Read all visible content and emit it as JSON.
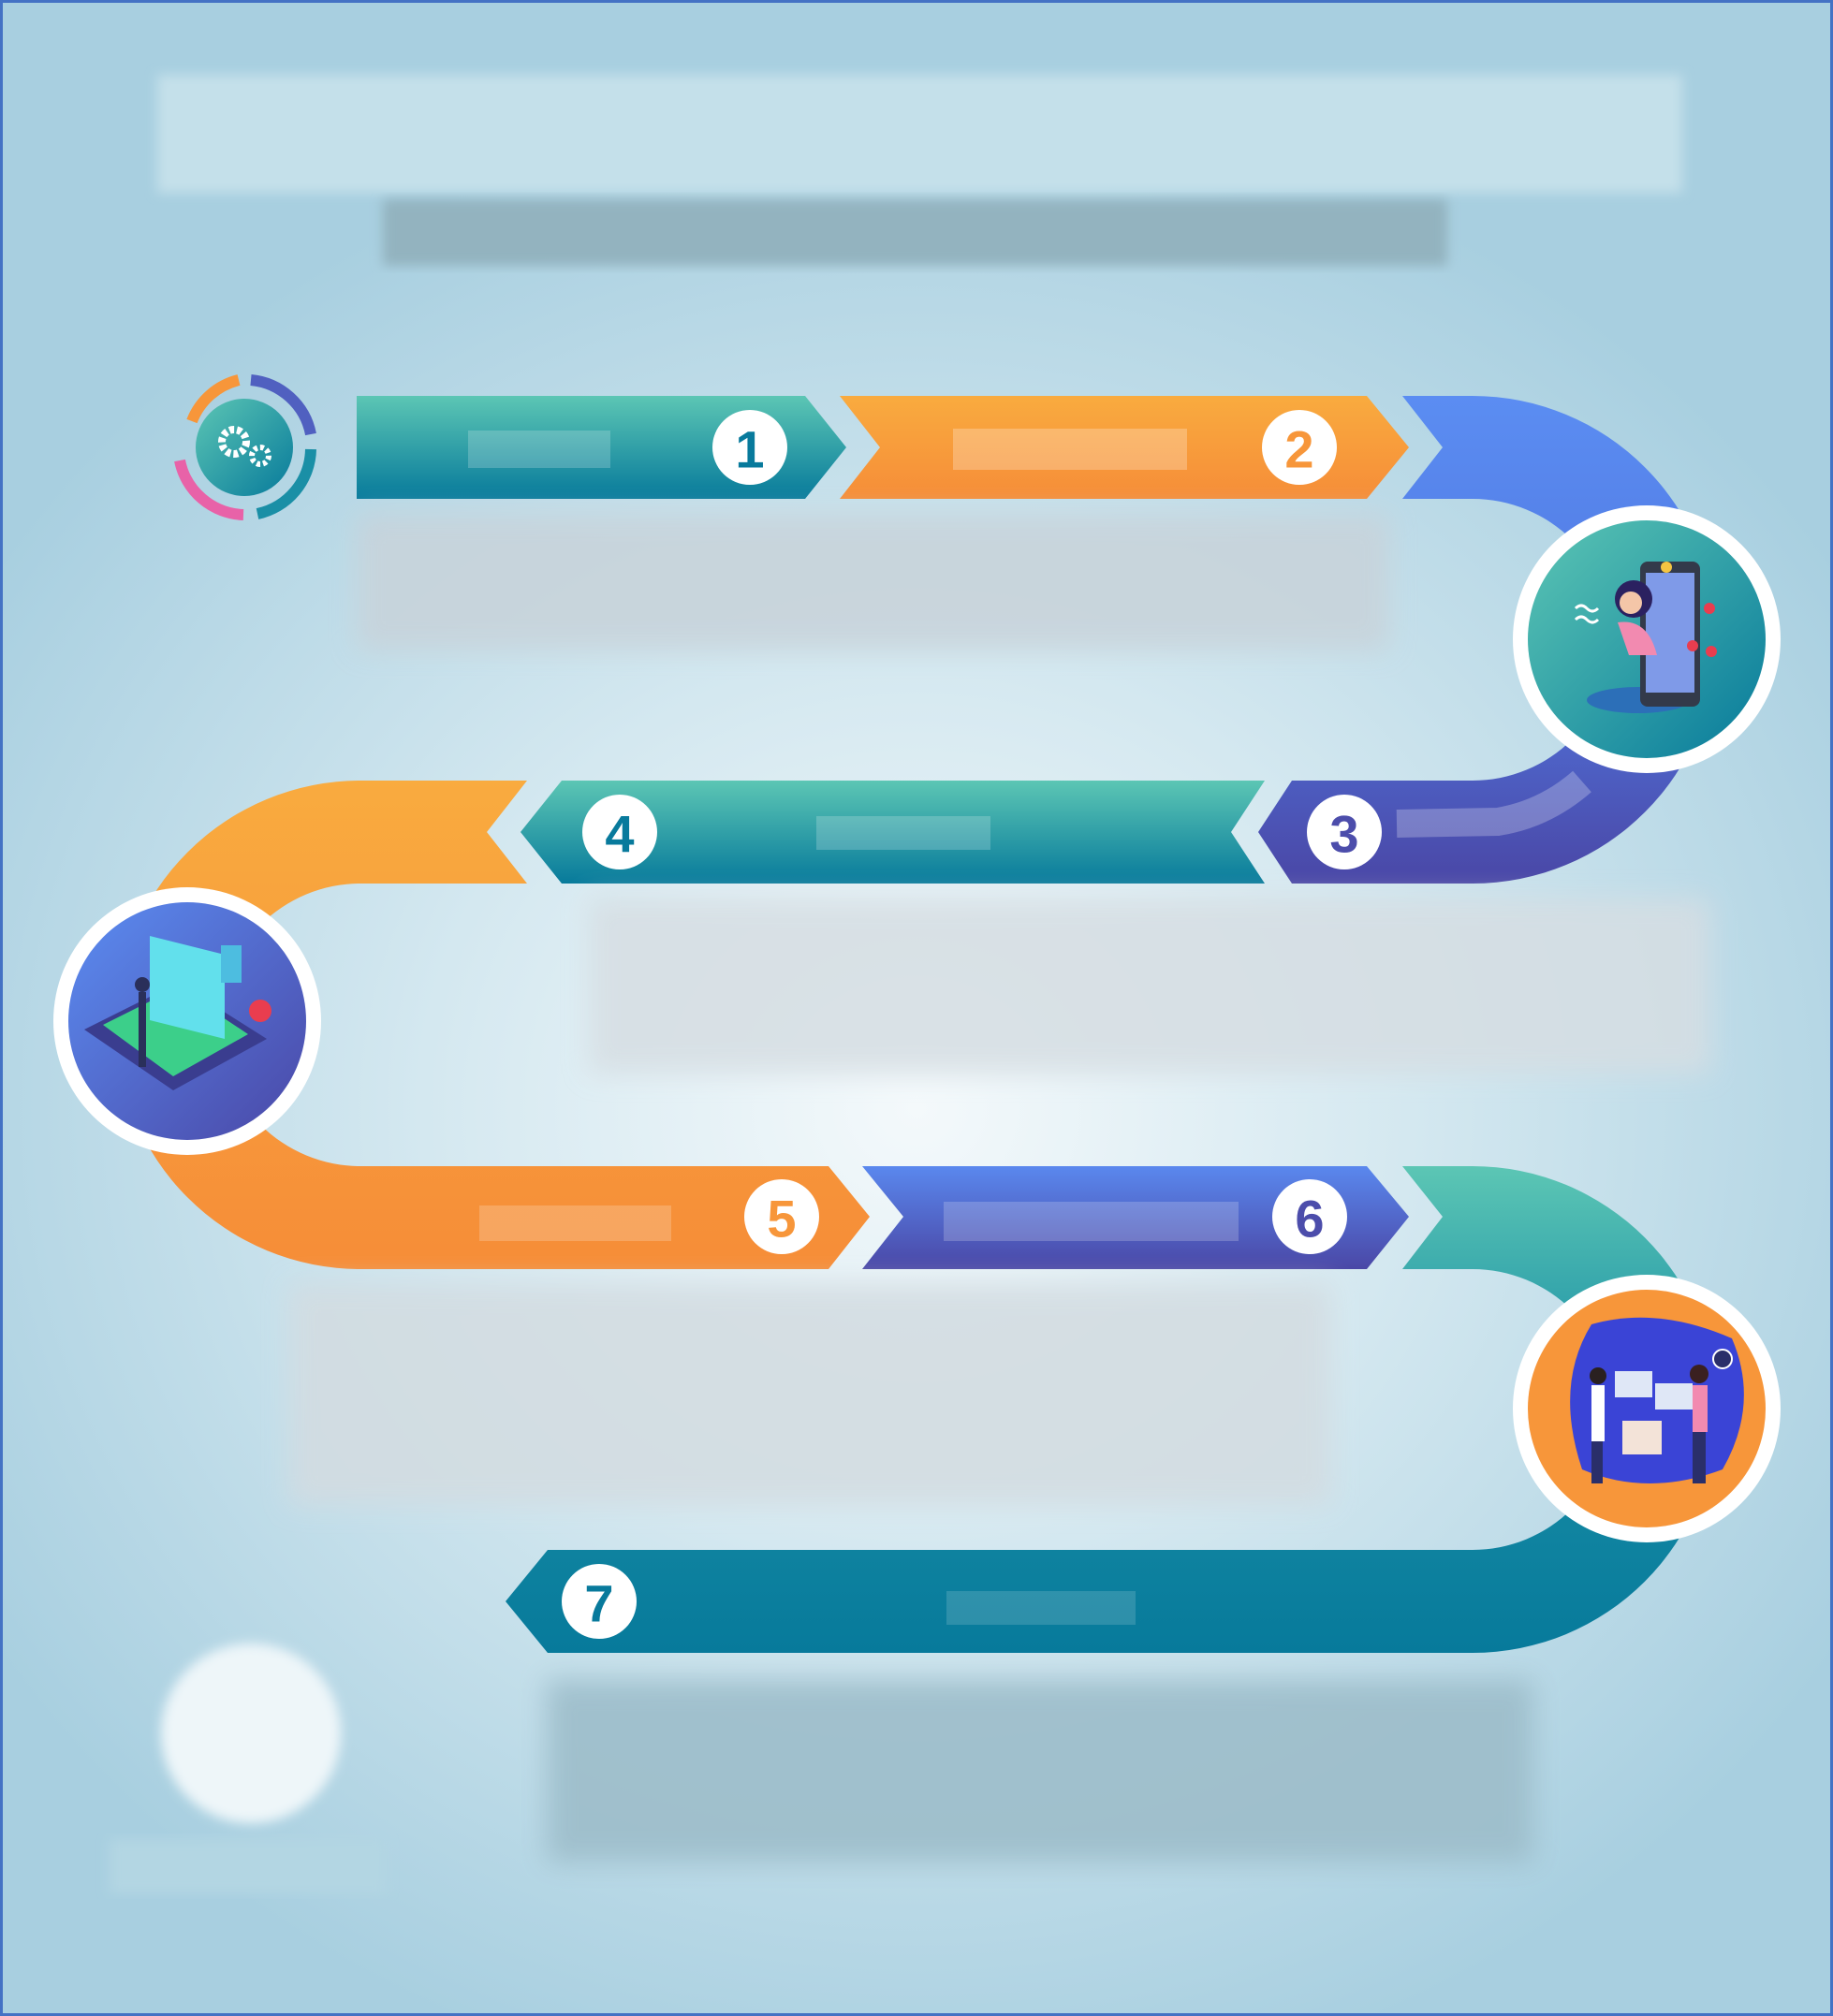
{
  "colors": {
    "teal": "#1f95a8",
    "orange": "#f7963a",
    "purple": "#4c4dab",
    "blue": "#5b8cf0",
    "dark_teal": "#087a9c",
    "frame": "#4472c4"
  },
  "steps": [
    {
      "number": "1",
      "color": "#087a9c"
    },
    {
      "number": "2",
      "color": "#f7963a"
    },
    {
      "number": "3",
      "color": "#4c4dab"
    },
    {
      "number": "4",
      "color": "#087a9c"
    },
    {
      "number": "5",
      "color": "#f7963a"
    },
    {
      "number": "6",
      "color": "#4c4dab"
    },
    {
      "number": "7",
      "color": "#087a9c"
    }
  ],
  "icons": [
    "gears-icon",
    "social-media-illustration",
    "laptop-illustration",
    "team-illustration"
  ]
}
